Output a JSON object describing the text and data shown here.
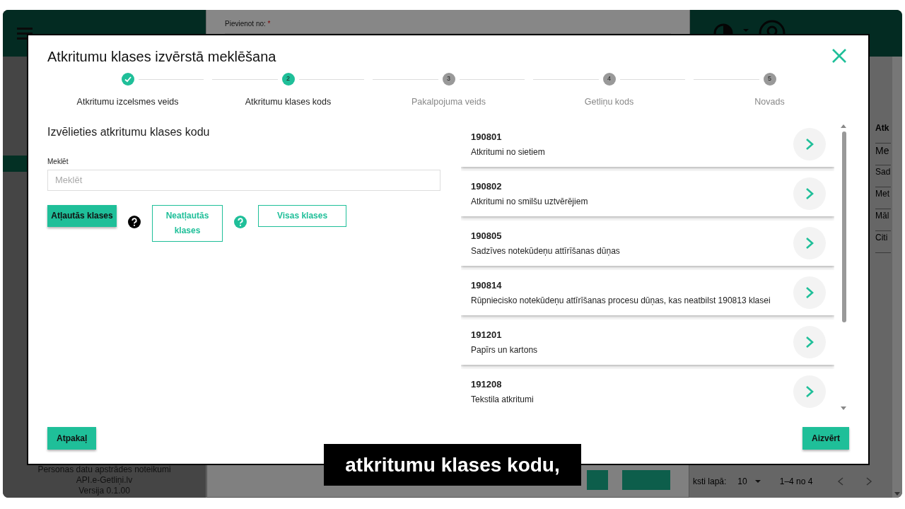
{
  "background": {
    "field_label": "Pievienot no:",
    "required_mark": "*",
    "table_cells": [
      {
        "kind": "header",
        "text": "Atk"
      },
      {
        "kind": "input",
        "text": "Me"
      },
      {
        "kind": "cell",
        "text": "Sad"
      },
      {
        "kind": "cell",
        "text": "Met"
      },
      {
        "kind": "cell",
        "text": "Māl"
      },
      {
        "kind": "cell",
        "text": "Citi"
      }
    ],
    "footer_links": [
      "Personas datu apstrādes noteikumi",
      "API.e-Getliņi.lv"
    ],
    "version": "Versija 0.1.00",
    "rows_per_page_label": "ksti lapā:",
    "rows_per_page": "10",
    "range": "1–4 no 4"
  },
  "modal": {
    "title": "Atkritumu klases izvērstā meklēšana",
    "steps": [
      {
        "label": "Atkritumu izcelsmes veids",
        "completed": true,
        "current": false
      },
      {
        "label": "Atkritumu klases kods",
        "number": "2",
        "completed": false,
        "current": true
      },
      {
        "label": "Pakalpojuma veids",
        "number": "3",
        "completed": false,
        "current": false
      },
      {
        "label": "Getliņu kods",
        "number": "4",
        "completed": false,
        "current": false
      },
      {
        "label": "Novads",
        "number": "5",
        "completed": false,
        "current": false
      }
    ],
    "section_title": "Izvēlieties atkritumu klases kodu",
    "search": {
      "label": "Meklēt",
      "placeholder": "Meklēt"
    },
    "filters": [
      {
        "label": "Atļautās klases",
        "selected": true,
        "help": {
          "color": "#000000"
        }
      },
      {
        "label": "Neatļautās klases",
        "selected": false,
        "help": {
          "color": "#1fbf99"
        }
      },
      {
        "label": "Visas klases",
        "selected": false
      }
    ],
    "results": [
      {
        "code": "190801",
        "name": "Atkritumi no sietiem"
      },
      {
        "code": "190802",
        "name": "Atkritumi no smilšu uztvērējiem"
      },
      {
        "code": "190805",
        "name": "Sadzīves notekūdeņu attīrīšanas dūņas"
      },
      {
        "code": "190814",
        "name": "Rūpniecisko notekūdeņu attīrīšanas procesu dūņas, kas neatbilst 190813 klasei"
      },
      {
        "code": "191201",
        "name": "Papīrs un kartons"
      },
      {
        "code": "191208",
        "name": "Tekstila atkritumi"
      }
    ],
    "buttons": {
      "back": "Atpakaļ",
      "close": "Aizvērt"
    }
  },
  "subtitle": "atkritumu klases kodu,"
}
